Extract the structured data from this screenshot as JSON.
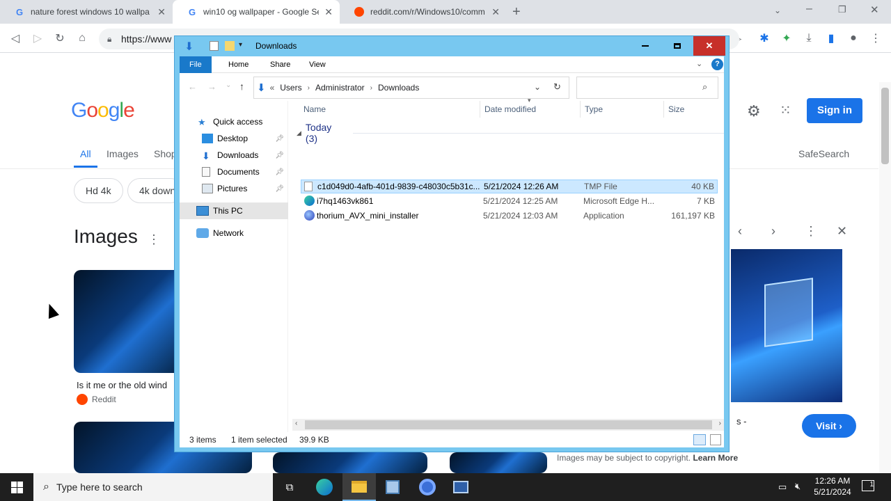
{
  "browser": {
    "tabs": [
      {
        "title": "nature forest windows 10 wallpa",
        "favicon": "google-icon"
      },
      {
        "title": "win10 og wallpaper - Google Se",
        "favicon": "google-icon"
      },
      {
        "title": "reddit.com/r/Windows10/comm",
        "favicon": "reddit-icon"
      }
    ],
    "url": "https://www"
  },
  "google": {
    "logo": "Google",
    "nav_tabs": [
      "All",
      "Images",
      "Shop"
    ],
    "safesearch": "SafeSearch",
    "sign_in": "Sign in",
    "chips": [
      "Hd 4k",
      "4k down"
    ],
    "images_title": "Images",
    "result_caption": "Is it me or the old wind",
    "result_source": "Reddit",
    "visit": "Visit ›",
    "copyright": "Images may be subject to copyright.",
    "learn_more": "Learn More"
  },
  "explorer": {
    "title": "Downloads",
    "ribbon_tabs": [
      "File",
      "Home",
      "Share",
      "View"
    ],
    "breadcrumb": [
      "Users",
      "Administrator",
      "Downloads"
    ],
    "nav": {
      "quick_access": "Quick access",
      "items": [
        "Desktop",
        "Downloads",
        "Documents",
        "Pictures"
      ],
      "this_pc": "This PC",
      "network": "Network"
    },
    "columns": [
      "Name",
      "Date modified",
      "Type",
      "Size"
    ],
    "group": "Today (3)",
    "files": [
      {
        "name": "c1d049d0-4afb-401d-9839-c48030c5b31c...",
        "date": "5/21/2024 12:26 AM",
        "type": "TMP File",
        "size": "40 KB"
      },
      {
        "name": "i7hq1463vk861",
        "date": "5/21/2024 12:25 AM",
        "type": "Microsoft Edge H...",
        "size": "7 KB"
      },
      {
        "name": "thorium_AVX_mini_installer",
        "date": "5/21/2024 12:03 AM",
        "type": "Application",
        "size": "161,197 KB"
      }
    ],
    "status": {
      "count": "3 items",
      "selected": "1 item selected",
      "size": "39.9 KB"
    }
  },
  "taskbar": {
    "search_placeholder": "Type here to search",
    "time": "12:26 AM",
    "date": "5/21/2024",
    "notifications": "1"
  }
}
